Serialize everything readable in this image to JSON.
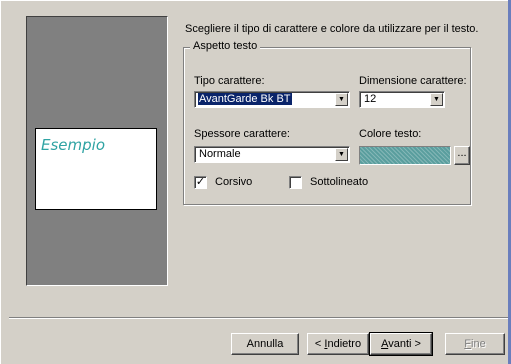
{
  "instruction": "Scegliere il tipo di carattere e colore da utilizzare per il testo.",
  "preview": {
    "sample_text": "Esempio",
    "sample_color": "#2fa3a3"
  },
  "group": {
    "title": "Aspetto testo",
    "font_type": {
      "label": "Tipo carattere:",
      "value": "AvantGarde Bk BT"
    },
    "font_size": {
      "label": "Dimensione carattere:",
      "value": "12"
    },
    "font_weight": {
      "label": "Spessore carattere:",
      "value": "Normale"
    },
    "text_color": {
      "label": "Colore testo:",
      "swatch": "#5a9e9e",
      "picker_label": "..."
    },
    "italic": {
      "label": "Corsivo",
      "checked": true,
      "mark": "✓"
    },
    "underline": {
      "label": "Sottolineato",
      "checked": false
    }
  },
  "buttons": {
    "cancel": "Annulla",
    "back_prefix": "< ",
    "back_key": "I",
    "back_rest": "ndietro",
    "next_key": "A",
    "next_rest": "vanti >",
    "finish_key": "F",
    "finish_rest": "ine"
  },
  "colors": {
    "dialog_bg": "#d4d0c8",
    "preview_bg": "#808080",
    "selection": "#0a246a"
  }
}
